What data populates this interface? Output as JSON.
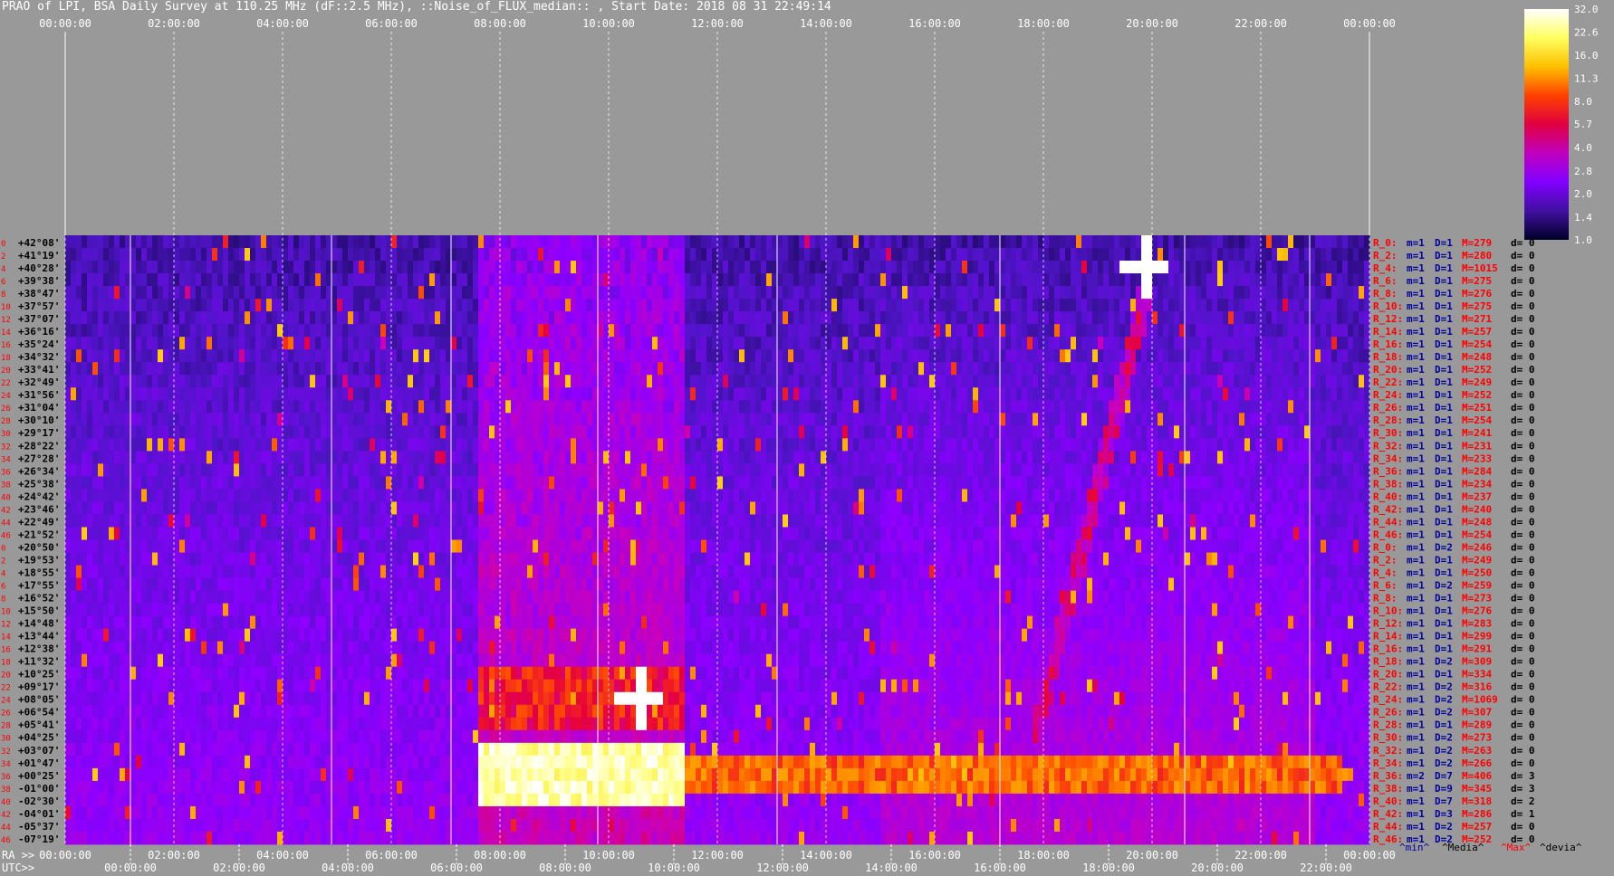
{
  "title": "PRAO of LPI, BSA Daily Survey at 110.25 MHz (dF::2.5 MHz), ::Noise_of_FLUX_median:: , Start Date: 2018 08 31 22:49:14",
  "chart_data": {
    "type": "heatmap",
    "title": "PRAO of LPI, BSA Daily Survey at 110.25 MHz (dF::2.5 MHz), ::Noise_of_FLUX_median:: , Start Date: 2018 08 31 22:49:14",
    "top_time_ticks": [
      "00:00:00",
      "02:00:00",
      "04:00:00",
      "06:00:00",
      "08:00:00",
      "10:00:00",
      "12:00:00",
      "14:00:00",
      "16:00:00",
      "18:00:00",
      "20:00:00",
      "22:00:00",
      "00:00:00"
    ],
    "ra_axis_label": "RA >>",
    "ra_ticks": [
      "00:00:00",
      "02:00:00",
      "04:00:00",
      "06:00:00",
      "08:00:00",
      "10:00:00",
      "12:00:00",
      "14:00:00",
      "16:00:00",
      "18:00:00",
      "20:00:00",
      "22:00:00",
      "00:00:00"
    ],
    "utc_axis_label": "UTC>>",
    "utc_ticks": [
      "00:00:00",
      "02:00:00",
      "04:00:00",
      "06:00:00",
      "08:00:00",
      "10:00:00",
      "12:00:00",
      "14:00:00",
      "16:00:00",
      "18:00:00",
      "20:00:00",
      "22:00:00"
    ],
    "colorbar": {
      "min": 1.0,
      "max": 32.0,
      "tick_labels": [
        "32.0",
        "22.6",
        "16.0",
        "11.3",
        "8.0",
        "5.7",
        "4.0",
        "2.8",
        "2.0",
        "1.4",
        "1.0"
      ],
      "colors": [
        "#ffffff",
        "#ffff60",
        "#ffc000",
        "#ff4000",
        "#e00040",
        "#c000c0",
        "#8000ff",
        "#4010a0",
        "#000028"
      ]
    },
    "rows": [
      {
        "idx": "0",
        "dec": "+42°08'",
        "stat": [
          "R_0:",
          "m=1",
          "D=1",
          "M=279",
          "d= 0"
        ]
      },
      {
        "idx": "2",
        "dec": "+41°19'",
        "stat": [
          "R_2:",
          "m=1",
          "D=1",
          "M=280",
          "d= 0"
        ]
      },
      {
        "idx": "4",
        "dec": "+40°28'",
        "stat": [
          "R_4:",
          "m=1",
          "D=1",
          "M=1015",
          "d= 0"
        ]
      },
      {
        "idx": "6",
        "dec": "+39°38'",
        "stat": [
          "R_6:",
          "m=1",
          "D=1",
          "M=275",
          "d= 0"
        ]
      },
      {
        "idx": "8",
        "dec": "+38°47'",
        "stat": [
          "R_8:",
          "m=1",
          "D=1",
          "M=276",
          "d= 0"
        ]
      },
      {
        "idx": "10",
        "dec": "+37°57'",
        "stat": [
          "R_10:",
          "m=1",
          "D=1",
          "M=275",
          "d= 0"
        ]
      },
      {
        "idx": "12",
        "dec": "+37°07'",
        "stat": [
          "R_12:",
          "m=1",
          "D=1",
          "M=271",
          "d= 0"
        ]
      },
      {
        "idx": "14",
        "dec": "+36°16'",
        "stat": [
          "R_14:",
          "m=1",
          "D=1",
          "M=257",
          "d= 0"
        ]
      },
      {
        "idx": "16",
        "dec": "+35°24'",
        "stat": [
          "R_16:",
          "m=1",
          "D=1",
          "M=254",
          "d= 0"
        ]
      },
      {
        "idx": "18",
        "dec": "+34°32'",
        "stat": [
          "R_18:",
          "m=1",
          "D=1",
          "M=248",
          "d= 0"
        ]
      },
      {
        "idx": "20",
        "dec": "+33°41'",
        "stat": [
          "R_20:",
          "m=1",
          "D=1",
          "M=252",
          "d= 0"
        ]
      },
      {
        "idx": "22",
        "dec": "+32°49'",
        "stat": [
          "R_22:",
          "m=1",
          "D=1",
          "M=249",
          "d= 0"
        ]
      },
      {
        "idx": "24",
        "dec": "+31°56'",
        "stat": [
          "R_24:",
          "m=1",
          "D=1",
          "M=252",
          "d= 0"
        ]
      },
      {
        "idx": "26",
        "dec": "+31°04'",
        "stat": [
          "R_26:",
          "m=1",
          "D=1",
          "M=251",
          "d= 0"
        ]
      },
      {
        "idx": "28",
        "dec": "+30°10'",
        "stat": [
          "R_28:",
          "m=1",
          "D=1",
          "M=254",
          "d= 0"
        ]
      },
      {
        "idx": "30",
        "dec": "+29°17'",
        "stat": [
          "R_30:",
          "m=1",
          "D=1",
          "M=241",
          "d= 0"
        ]
      },
      {
        "idx": "32",
        "dec": "+28°22'",
        "stat": [
          "R_32:",
          "m=1",
          "D=1",
          "M=231",
          "d= 0"
        ]
      },
      {
        "idx": "34",
        "dec": "+27°28'",
        "stat": [
          "R_34:",
          "m=1",
          "D=1",
          "M=233",
          "d= 0"
        ]
      },
      {
        "idx": "36",
        "dec": "+26°34'",
        "stat": [
          "R_36:",
          "m=1",
          "D=1",
          "M=284",
          "d= 0"
        ]
      },
      {
        "idx": "38",
        "dec": "+25°38'",
        "stat": [
          "R_38:",
          "m=1",
          "D=1",
          "M=234",
          "d= 0"
        ]
      },
      {
        "idx": "40",
        "dec": "+24°42'",
        "stat": [
          "R_40:",
          "m=1",
          "D=1",
          "M=237",
          "d= 0"
        ]
      },
      {
        "idx": "42",
        "dec": "+23°46'",
        "stat": [
          "R_42:",
          "m=1",
          "D=1",
          "M=240",
          "d= 0"
        ]
      },
      {
        "idx": "44",
        "dec": "+22°49'",
        "stat": [
          "R_44:",
          "m=1",
          "D=1",
          "M=248",
          "d= 0"
        ]
      },
      {
        "idx": "46",
        "dec": "+21°52'",
        "stat": [
          "R_46:",
          "m=1",
          "D=1",
          "M=254",
          "d= 0"
        ]
      },
      {
        "idx": "0",
        "dec": "+20°50'",
        "stat": [
          "R_0:",
          "m=1",
          "D=2",
          "M=246",
          "d= 0"
        ]
      },
      {
        "idx": "2",
        "dec": "+19°53'",
        "stat": [
          "R_2:",
          "m=1",
          "D=1",
          "M=249",
          "d= 0"
        ]
      },
      {
        "idx": "4",
        "dec": "+18°55'",
        "stat": [
          "R_4:",
          "m=1",
          "D=1",
          "M=250",
          "d= 0"
        ]
      },
      {
        "idx": "6",
        "dec": "+17°55'",
        "stat": [
          "R_6:",
          "m=1",
          "D=2",
          "M=259",
          "d= 0"
        ]
      },
      {
        "idx": "8",
        "dec": "+16°52'",
        "stat": [
          "R_8:",
          "m=1",
          "D=1",
          "M=273",
          "d= 0"
        ]
      },
      {
        "idx": "10",
        "dec": "+15°50'",
        "stat": [
          "R_10:",
          "m=1",
          "D=1",
          "M=276",
          "d= 0"
        ]
      },
      {
        "idx": "12",
        "dec": "+14°48'",
        "stat": [
          "R_12:",
          "m=1",
          "D=1",
          "M=283",
          "d= 0"
        ]
      },
      {
        "idx": "14",
        "dec": "+13°44'",
        "stat": [
          "R_14:",
          "m=1",
          "D=1",
          "M=299",
          "d= 0"
        ]
      },
      {
        "idx": "16",
        "dec": "+12°38'",
        "stat": [
          "R_16:",
          "m=1",
          "D=1",
          "M=291",
          "d= 0"
        ]
      },
      {
        "idx": "18",
        "dec": "+11°32'",
        "stat": [
          "R_18:",
          "m=1",
          "D=2",
          "M=309",
          "d= 0"
        ]
      },
      {
        "idx": "20",
        "dec": "+10°25'",
        "stat": [
          "R_20:",
          "m=1",
          "D=1",
          "M=334",
          "d= 0"
        ]
      },
      {
        "idx": "22",
        "dec": "+09°17'",
        "stat": [
          "R_22:",
          "m=1",
          "D=2",
          "M=316",
          "d= 0"
        ]
      },
      {
        "idx": "24",
        "dec": "+08°05'",
        "stat": [
          "R_24:",
          "m=1",
          "D=2",
          "M=1069",
          "d= 0"
        ]
      },
      {
        "idx": "26",
        "dec": "+06°54'",
        "stat": [
          "R_26:",
          "m=1",
          "D=2",
          "M=307",
          "d= 0"
        ]
      },
      {
        "idx": "28",
        "dec": "+05°41'",
        "stat": [
          "R_28:",
          "m=1",
          "D=1",
          "M=289",
          "d= 0"
        ]
      },
      {
        "idx": "30",
        "dec": "+04°25'",
        "stat": [
          "R_30:",
          "m=1",
          "D=2",
          "M=273",
          "d= 0"
        ]
      },
      {
        "idx": "32",
        "dec": "+03°07'",
        "stat": [
          "R_32:",
          "m=1",
          "D=2",
          "M=263",
          "d= 0"
        ]
      },
      {
        "idx": "34",
        "dec": "+01°47'",
        "stat": [
          "R_34:",
          "m=1",
          "D=2",
          "M=266",
          "d= 0"
        ]
      },
      {
        "idx": "36",
        "dec": "+00°25'",
        "stat": [
          "R_36:",
          "m=2",
          "D=7",
          "M=406",
          "d= 3"
        ]
      },
      {
        "idx": "38",
        "dec": "-01°00'",
        "stat": [
          "R_38:",
          "m=1",
          "D=9",
          "M=345",
          "d= 3"
        ]
      },
      {
        "idx": "40",
        "dec": "-02°30'",
        "stat": [
          "R_40:",
          "m=1",
          "D=7",
          "M=318",
          "d= 2"
        ]
      },
      {
        "idx": "42",
        "dec": "-04°01'",
        "stat": [
          "R_42:",
          "m=1",
          "D=3",
          "M=286",
          "d= 1"
        ]
      },
      {
        "idx": "44",
        "dec": "-05°37'",
        "stat": [
          "R_44:",
          "m=1",
          "D=2",
          "M=257",
          "d= 0"
        ]
      },
      {
        "idx": "46",
        "dec": "-07°19'",
        "stat": [
          "R_46:",
          "m=1",
          "D=2",
          "M=252",
          "d= 0"
        ]
      }
    ],
    "stat_legend": [
      "^min^",
      "^Media^",
      "^Max^",
      "^devia^"
    ],
    "stat_legend_colors": [
      "#0000a0",
      "#000000",
      "#ff0000",
      "#000000"
    ],
    "features": [
      {
        "kind": "horizontal-band",
        "from_hour": 7.6,
        "to_hour": 11.4,
        "rows": [
          40,
          44
        ],
        "level": 32
      },
      {
        "kind": "horizontal-band",
        "from_hour": 11.4,
        "to_hour": 23.5,
        "rows": [
          41,
          43
        ],
        "level": 11
      },
      {
        "kind": "horizontal-band",
        "from_hour": 7.6,
        "to_hour": 11.4,
        "rows": [
          34,
          38
        ],
        "level": 8
      },
      {
        "kind": "bright-source",
        "hour": 19.9,
        "row": 2,
        "level": 32
      },
      {
        "kind": "bright-source",
        "hour": 10.6,
        "row": 36,
        "level": 32
      },
      {
        "kind": "drift-ridge",
        "from_hour": 17.8,
        "to_hour": 20.0,
        "level": 6
      }
    ]
  }
}
